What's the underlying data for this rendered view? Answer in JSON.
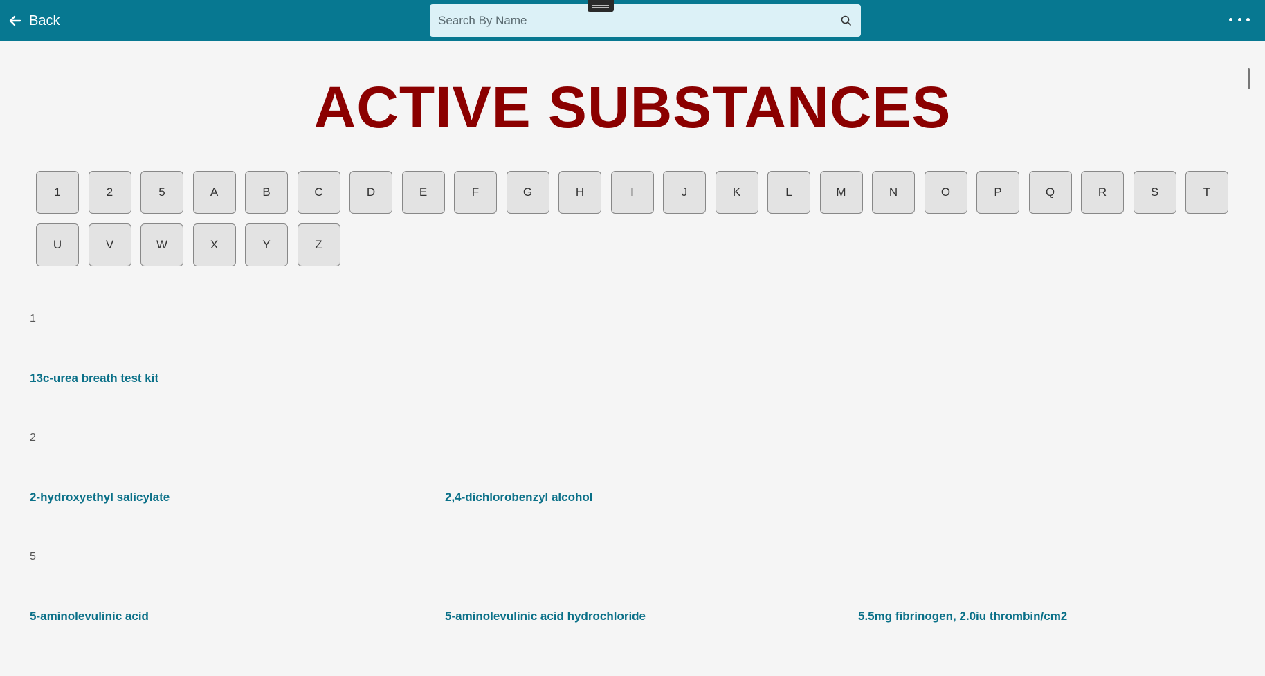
{
  "header": {
    "back_label": "Back",
    "search_placeholder": "Search By Name",
    "colors": {
      "bar": "#077891",
      "search_bg": "#dcf1f7"
    }
  },
  "page": {
    "title": "ACTIVE SUBSTANCES",
    "title_color": "#8b0000",
    "link_color": "#0a7088"
  },
  "letters": [
    "1",
    "2",
    "5",
    "A",
    "B",
    "C",
    "D",
    "E",
    "F",
    "G",
    "H",
    "I",
    "J",
    "K",
    "L",
    "M",
    "N",
    "O",
    "P",
    "Q",
    "R",
    "S",
    "T",
    "U",
    "V",
    "W",
    "X",
    "Y",
    "Z"
  ],
  "sections": [
    {
      "heading": "1",
      "items": [
        "13c-urea breath test kit"
      ]
    },
    {
      "heading": "2",
      "items": [
        "2-hydroxyethyl salicylate",
        "2,4-dichlorobenzyl alcohol"
      ]
    },
    {
      "heading": "5",
      "items": [
        "5-aminolevulinic acid",
        "5-aminolevulinic acid hydrochloride",
        "5.5mg fibrinogen, 2.0iu thrombin/cm2"
      ]
    }
  ]
}
